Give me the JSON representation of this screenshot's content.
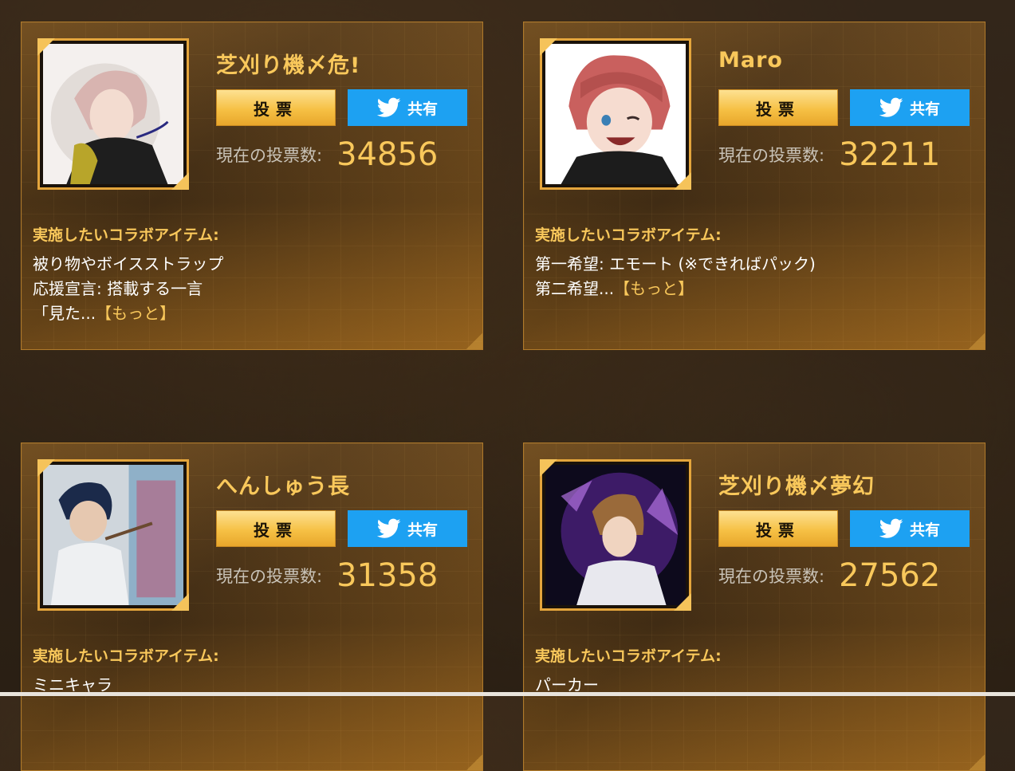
{
  "cards": [
    {
      "name": "芝刈り機〆危!",
      "vote_label": "投票",
      "share_label": "共有",
      "count_label": "現在の投票数:",
      "count_value": "34856",
      "collab_label": "実施したいコラボアイテム:",
      "desc_lines": [
        "被り物やボイスストラップ",
        "応援宣言: 搭載する一言",
        "「見た..."
      ],
      "more_label": "【もっと】",
      "avatar_icon": "character-avatar-icon"
    },
    {
      "name": "Maro",
      "vote_label": "投票",
      "share_label": "共有",
      "count_label": "現在の投票数:",
      "count_value": "32211",
      "collab_label": "実施したいコラボアイテム:",
      "desc_lines": [
        "第一希望: エモート (※できればパック)",
        "第二希望..."
      ],
      "more_label": "【もっと】",
      "avatar_icon": "character-avatar-icon"
    },
    {
      "name": "へんしゅう長",
      "vote_label": "投票",
      "share_label": "共有",
      "count_label": "現在の投票数:",
      "count_value": "31358",
      "collab_label": "実施したいコラボアイテム:",
      "desc_lines": [
        "ミニキャラ"
      ],
      "more_label": "",
      "avatar_icon": "photo-avatar-icon"
    },
    {
      "name": "芝刈り機〆夢幻",
      "vote_label": "投票",
      "share_label": "共有",
      "count_label": "現在の投票数:",
      "count_value": "27562",
      "collab_label": "実施したいコラボアイテム:",
      "desc_lines": [
        "パーカー"
      ],
      "more_label": "",
      "avatar_icon": "character-avatar-icon"
    }
  ],
  "colors": {
    "accent": "#f9c85b",
    "twitter": "#1da1f2",
    "vote_button": "#f6c145"
  },
  "icons": {
    "share": "twitter-bird-icon"
  }
}
